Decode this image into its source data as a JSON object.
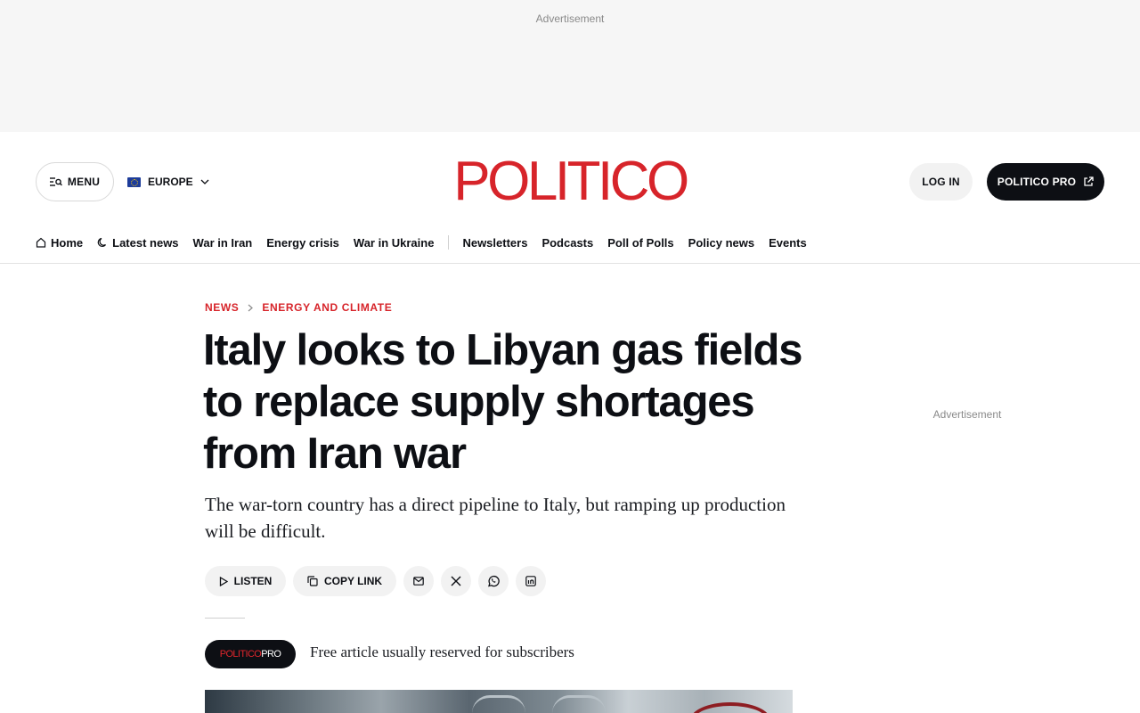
{
  "ad_top": {
    "label": "Advertisement"
  },
  "header": {
    "menu_label": "MENU",
    "region_label": "EUROPE",
    "logo_text": "POLITICO",
    "login_label": "LOG IN",
    "pro_label": "POLITICO PRO"
  },
  "nav": {
    "items": [
      {
        "label": "Home",
        "icon": "home-icon"
      },
      {
        "label": "Latest news",
        "icon": "moon-icon"
      },
      {
        "label": "War in Iran"
      },
      {
        "label": "Energy crisis"
      },
      {
        "label": "War in Ukraine"
      },
      {
        "label": "Newsletters"
      },
      {
        "label": "Podcasts"
      },
      {
        "label": "Poll of Polls"
      },
      {
        "label": "Policy news"
      },
      {
        "label": "Events"
      }
    ]
  },
  "article": {
    "breadcrumb": [
      "NEWS",
      "ENERGY AND CLIMATE"
    ],
    "headline": "Italy looks to Libyan gas fields to replace supply shortages from Iran war",
    "dek": "The war-torn country has a direct pipeline to Italy, but ramping up production will be difficult.",
    "share": {
      "listen_label": "LISTEN",
      "copy_label": "COPY LINK"
    },
    "pro_badge": {
      "politico": "POLITICO",
      "pro": "PRO"
    },
    "free_note": "Free article usually reserved for subscribers"
  },
  "ad_side": {
    "label": "Advertisement"
  },
  "colors": {
    "brand_red": "#d7242a",
    "ink": "#0d0f14",
    "pill_bg": "#f2f2f2",
    "ad_bg": "#f6f6f6"
  }
}
